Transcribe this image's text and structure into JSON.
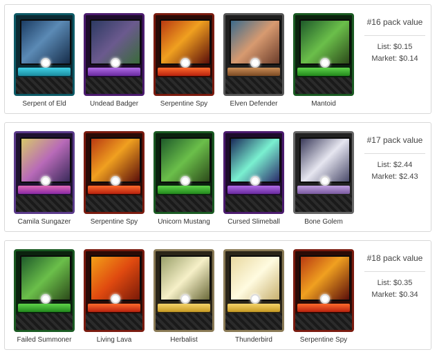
{
  "packs": [
    {
      "title": "#16 pack value",
      "list": "List: $0.15",
      "market": "Market: $0.14",
      "cards": [
        {
          "name": "Serpent of Eld"
        },
        {
          "name": "Undead Badger"
        },
        {
          "name": "Serpentine Spy"
        },
        {
          "name": "Elven Defender"
        },
        {
          "name": "Mantoid"
        }
      ]
    },
    {
      "title": "#17 pack value",
      "list": "List: $2.44",
      "market": "Market: $2.43",
      "cards": [
        {
          "name": "Camila Sungazer"
        },
        {
          "name": "Serpentine Spy"
        },
        {
          "name": "Unicorn Mustang"
        },
        {
          "name": "Cursed Slimeball"
        },
        {
          "name": "Bone Golem"
        }
      ]
    },
    {
      "title": "#18 pack value",
      "list": "List: $0.35",
      "market": "Market: $0.34",
      "cards": [
        {
          "name": "Failed Summoner"
        },
        {
          "name": "Living Lava"
        },
        {
          "name": "Herbalist"
        },
        {
          "name": "Thunderbird"
        },
        {
          "name": "Serpentine Spy"
        }
      ]
    }
  ]
}
